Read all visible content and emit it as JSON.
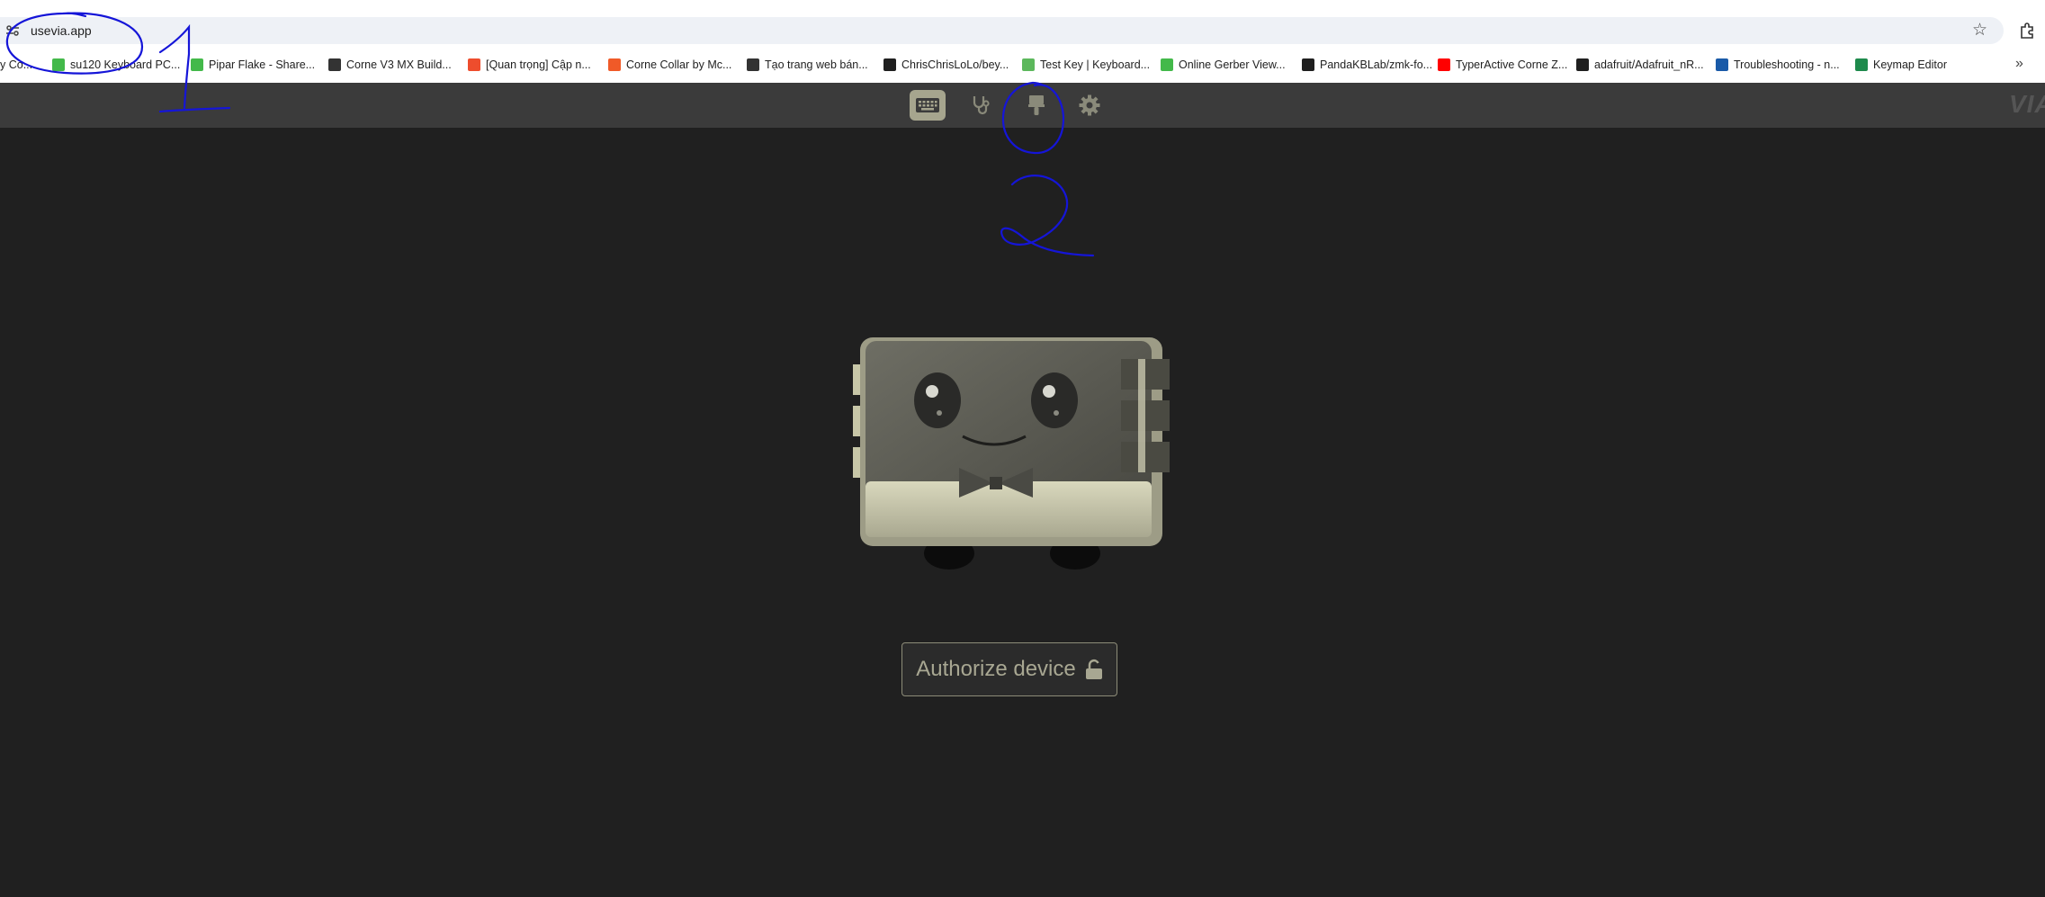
{
  "browser": {
    "url": "usevia.app",
    "bookmarks": [
      {
        "label": "y Co...",
        "icon": "bookmark-icon",
        "color": "#888888"
      },
      {
        "label": "su120 Keyboard PC...",
        "icon": "easyeda-icon",
        "color": "#43b94a"
      },
      {
        "label": "Pipar Flake - Share...",
        "icon": "easyeda-icon",
        "color": "#43b94a"
      },
      {
        "label": "Corne V3 MX Build...",
        "icon": "build-icon",
        "color": "#333333"
      },
      {
        "label": "[Quan trọng] Cập n...",
        "icon": "shopee-icon",
        "color": "#ee4d2d"
      },
      {
        "label": "Corne Collar by Mc...",
        "icon": "store-icon",
        "color": "#f05a28"
      },
      {
        "label": "Tạo trang web bán...",
        "icon": "chatgpt-icon",
        "color": "#333333"
      },
      {
        "label": "ChrisChrisLoLo/bey...",
        "icon": "github-icon",
        "color": "#1f1f1f"
      },
      {
        "label": "Test Key | Keyboard...",
        "icon": "keyboard-tester-icon",
        "color": "#5cb85c"
      },
      {
        "label": "Online Gerber View...",
        "icon": "easyeda-icon",
        "color": "#43b94a"
      },
      {
        "label": "PandaKBLab/zmk-fo...",
        "icon": "github-icon",
        "color": "#1f1f1f"
      },
      {
        "label": "TyperActive Corne Z...",
        "icon": "youtube-icon",
        "color": "#ff0000"
      },
      {
        "label": "adafruit/Adafruit_nR...",
        "icon": "github-icon",
        "color": "#1f1f1f"
      },
      {
        "label": "Troubleshooting - n...",
        "icon": "nrf-icon",
        "color": "#1a5aa8"
      },
      {
        "label": "Keymap Editor",
        "icon": "keymap-icon",
        "color": "#1e8a4c"
      }
    ]
  },
  "app": {
    "nav_items": [
      {
        "name": "configure",
        "icon": "keyboard-icon",
        "active": true
      },
      {
        "name": "test",
        "icon": "stethoscope-icon",
        "active": false
      },
      {
        "name": "design",
        "icon": "paintbrush-icon",
        "active": false
      },
      {
        "name": "settings",
        "icon": "gear-icon",
        "active": false
      }
    ],
    "logo": "VIA",
    "authorize_label": "Authorize device",
    "accent_color": "#a6a58e"
  },
  "annotations": {
    "step1": "1",
    "step2": "2",
    "ink_color": "#1515d8"
  }
}
